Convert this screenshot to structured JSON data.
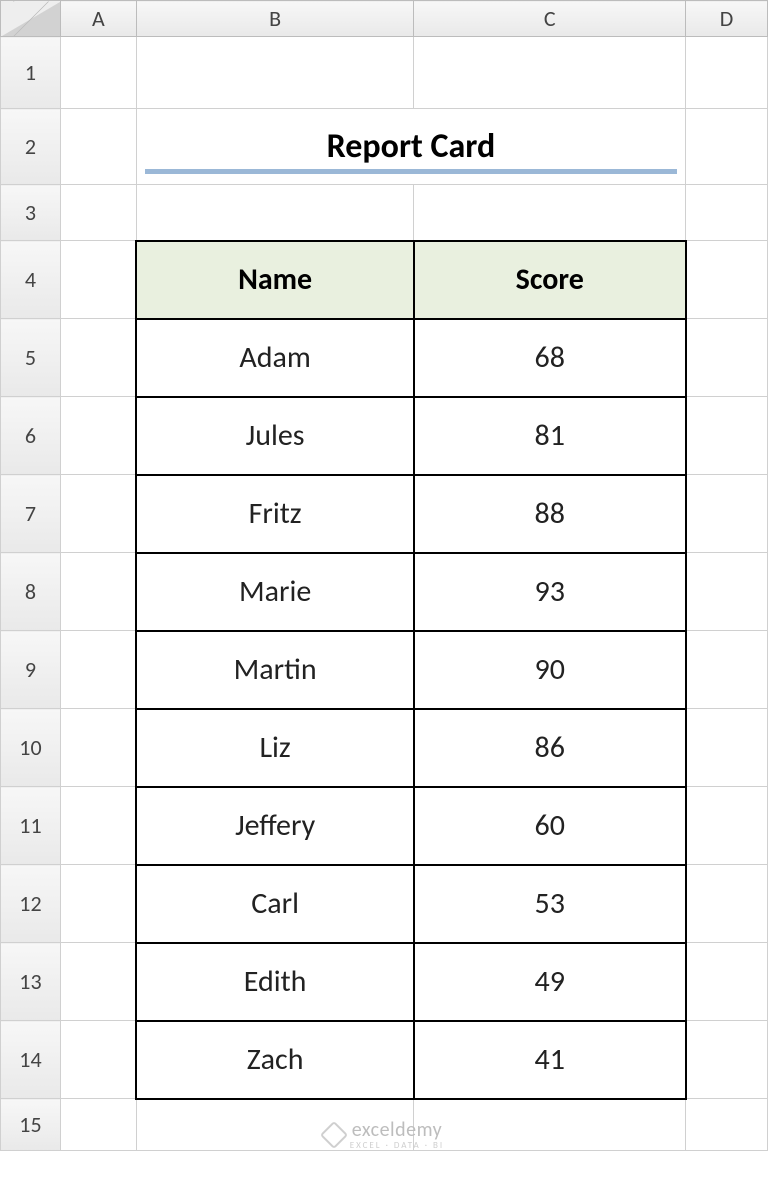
{
  "columns": [
    "A",
    "B",
    "C",
    "D"
  ],
  "rows": [
    "1",
    "2",
    "3",
    "4",
    "5",
    "6",
    "7",
    "8",
    "9",
    "10",
    "11",
    "12",
    "13",
    "14",
    "15"
  ],
  "title": "Report Card",
  "table": {
    "headers": {
      "name": "Name",
      "score": "Score"
    },
    "data": [
      {
        "name": "Adam",
        "score": "68"
      },
      {
        "name": "Jules",
        "score": "81"
      },
      {
        "name": "Fritz",
        "score": "88"
      },
      {
        "name": "Marie",
        "score": "93"
      },
      {
        "name": "Martin",
        "score": "90"
      },
      {
        "name": "Liz",
        "score": "86"
      },
      {
        "name": "Jeffery",
        "score": "60"
      },
      {
        "name": "Carl",
        "score": "53"
      },
      {
        "name": "Edith",
        "score": "49"
      },
      {
        "name": "Zach",
        "score": "41"
      }
    ]
  },
  "watermark": {
    "brand": "exceldemy",
    "tag": "EXCEL · DATA · BI"
  }
}
